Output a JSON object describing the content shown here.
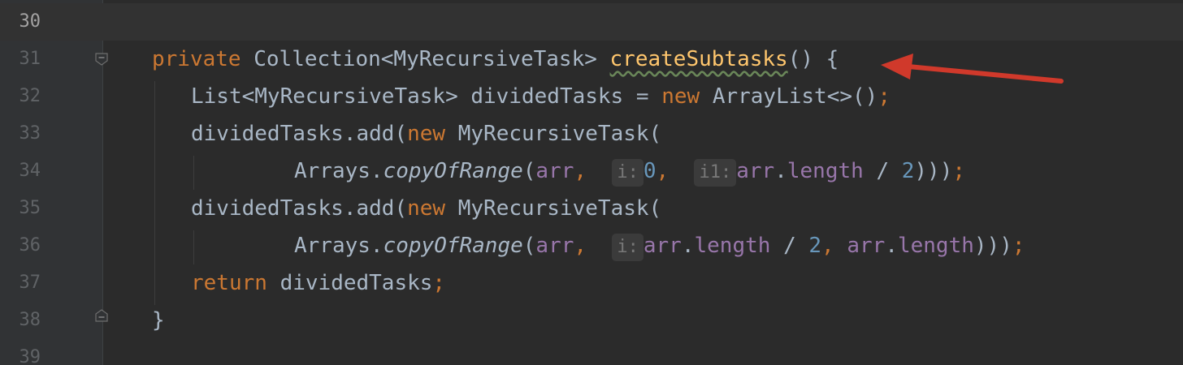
{
  "editor": {
    "lines": [
      {
        "number": "30"
      },
      {
        "number": "31",
        "tokens": [
          "private",
          "Collection<MyRecursiveTask>",
          "createSubtasks",
          "()",
          "{"
        ]
      },
      {
        "number": "32",
        "tokens": [
          "List<MyRecursiveTask> dividedTasks = ",
          "new",
          "ArrayList<>()",
          ";"
        ]
      },
      {
        "number": "33",
        "tokens": [
          "dividedTasks.add(",
          "new",
          "MyRecursiveTask("
        ]
      },
      {
        "number": "34",
        "tokens": [
          "Arrays.",
          "copyOfRange",
          "(",
          "arr",
          ",",
          "i:",
          "0",
          ",",
          "i1:",
          "arr",
          ".",
          "length",
          "/",
          "2",
          ")))",
          ";"
        ]
      },
      {
        "number": "35",
        "tokens": [
          "dividedTasks.add(",
          "new",
          "MyRecursiveTask("
        ]
      },
      {
        "number": "36",
        "tokens": [
          "Arrays.",
          "copyOfRange",
          "(",
          "arr",
          ",",
          "i:",
          "arr",
          ".",
          "length",
          "/",
          "2",
          ",",
          "arr",
          ".",
          "length",
          ")))",
          ";"
        ]
      },
      {
        "number": "37",
        "tokens": [
          "return",
          "dividedTasks",
          ";"
        ]
      },
      {
        "number": "38",
        "tokens": [
          "}"
        ]
      },
      {
        "number": "39"
      }
    ]
  },
  "colors": {
    "background": "#2b2b2b",
    "gutter": "#313335",
    "keyword": "#cc7832",
    "method": "#ffc66d",
    "field": "#9876aa",
    "number": "#6897bb",
    "text": "#a9b7c6",
    "annotation_arrow": "#d0392b"
  },
  "icons": {
    "fold_open": "fold-collapse-icon",
    "fold_close": "fold-end-icon",
    "arrow": "red-annotation-arrow-icon"
  }
}
